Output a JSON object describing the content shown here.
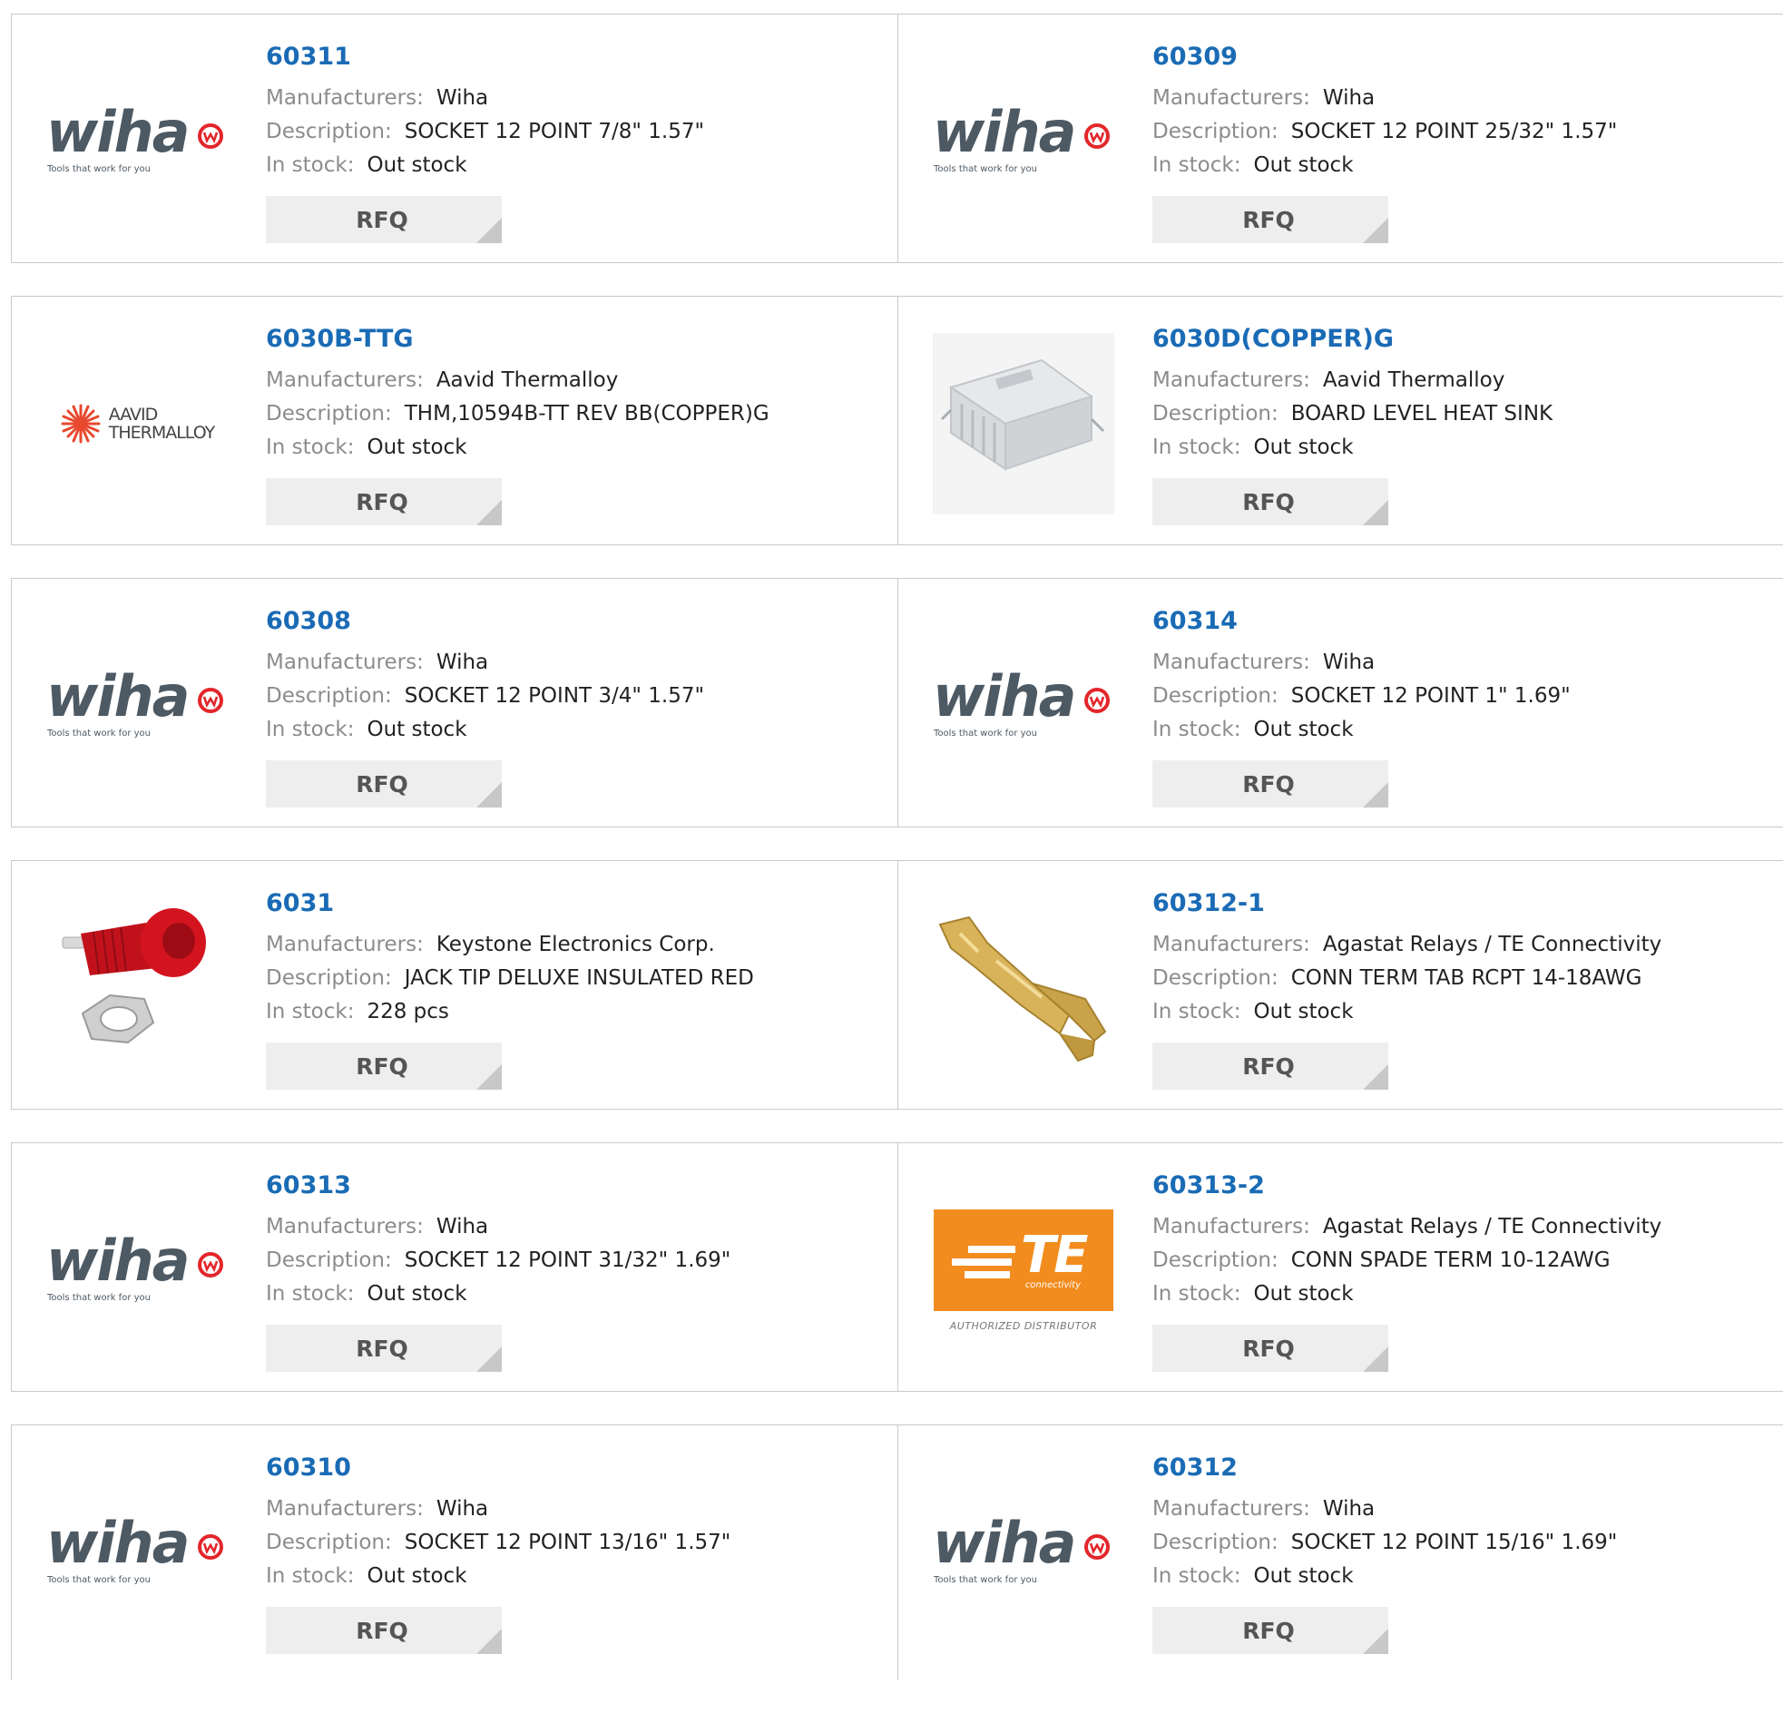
{
  "labels": {
    "manufacturers": "Manufacturers:",
    "description": "Description:",
    "in_stock": "In stock:",
    "rfq": "RFQ"
  },
  "logos": {
    "wiha_word": "wiha",
    "wiha_tagline": "Tools that work for you",
    "aavid_line1": "AAVID",
    "aavid_line2": "THERMALLOY",
    "te_mark": "TE",
    "te_sub": "connectivity",
    "te_distributor": "AUTHORIZED DISTRIBUTOR"
  },
  "colors": {
    "part_link": "#1a6bb5",
    "label_gray": "#8c8c8c",
    "rfq_bg": "#eeeeee",
    "border": "#c9c9c9"
  },
  "products": [
    {
      "part": "60311",
      "manufacturer": "Wiha",
      "description": "SOCKET 12 POINT 7/8\" 1.57\"",
      "stock": "Out stock",
      "image": "wiha-logo"
    },
    {
      "part": "60309",
      "manufacturer": "Wiha",
      "description": "SOCKET 12 POINT 25/32\" 1.57\"",
      "stock": "Out stock",
      "image": "wiha-logo"
    },
    {
      "part": "6030B-TTG",
      "manufacturer": "Aavid Thermalloy",
      "description": "THM,10594B-TT REV BB(COPPER)G",
      "stock": "Out stock",
      "image": "aavid-thermalloy-logo"
    },
    {
      "part": "6030D(COPPER)G",
      "manufacturer": "Aavid Thermalloy",
      "description": "BOARD LEVEL HEAT SINK",
      "stock": "Out stock",
      "image": "heat-sink-photo"
    },
    {
      "part": "60308",
      "manufacturer": "Wiha",
      "description": "SOCKET 12 POINT 3/4\" 1.57\"",
      "stock": "Out stock",
      "image": "wiha-logo"
    },
    {
      "part": "60314",
      "manufacturer": "Wiha",
      "description": "SOCKET 12 POINT 1\" 1.69\"",
      "stock": "Out stock",
      "image": "wiha-logo"
    },
    {
      "part": "6031",
      "manufacturer": "Keystone Electronics Corp.",
      "description": "JACK TIP DELUXE INSULATED RED",
      "stock": "228 pcs",
      "image": "red-jack-photo"
    },
    {
      "part": "60312-1",
      "manufacturer": "Agastat Relays / TE Connectivity",
      "description": "CONN TERM TAB RCPT 14-18AWG",
      "stock": "Out stock",
      "image": "brass-terminal-photo"
    },
    {
      "part": "60313",
      "manufacturer": "Wiha",
      "description": "SOCKET 12 POINT 31/32\" 1.69\"",
      "stock": "Out stock",
      "image": "wiha-logo"
    },
    {
      "part": "60313-2",
      "manufacturer": "Agastat Relays / TE Connectivity",
      "description": "CONN SPADE TERM 10-12AWG",
      "stock": "Out stock",
      "image": "te-connectivity-logo"
    },
    {
      "part": "60310",
      "manufacturer": "Wiha",
      "description": "SOCKET 12 POINT 13/16\" 1.57\"",
      "stock": "Out stock",
      "image": "wiha-logo"
    },
    {
      "part": "60312",
      "manufacturer": "Wiha",
      "description": "SOCKET 12 POINT 15/16\" 1.69\"",
      "stock": "Out stock",
      "image": "wiha-logo"
    }
  ]
}
